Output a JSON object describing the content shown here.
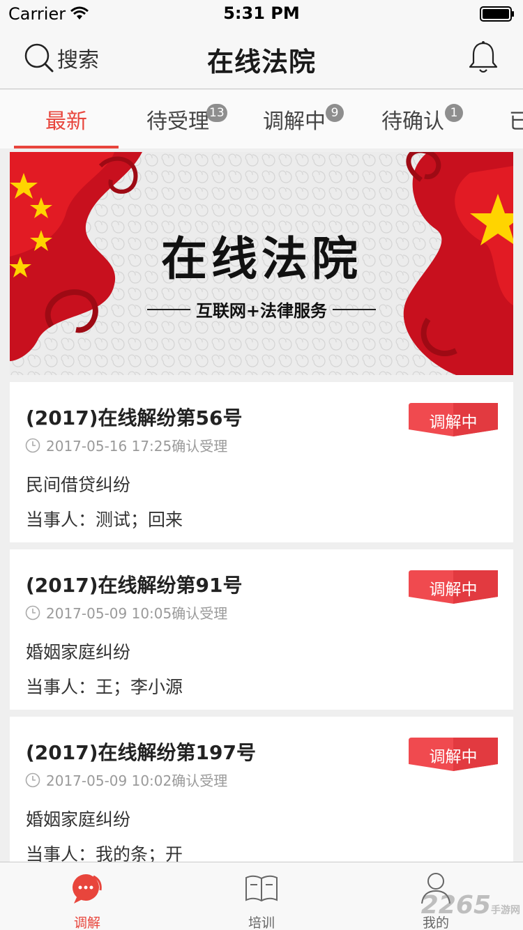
{
  "status_bar": {
    "carrier": "Carrier",
    "time": "5:31 PM"
  },
  "nav": {
    "search_label": "搜索",
    "title": "在线法院"
  },
  "tabs": [
    {
      "label": "最新",
      "badge": ""
    },
    {
      "label": "待受理",
      "badge": "13"
    },
    {
      "label": "调解中",
      "badge": "9"
    },
    {
      "label": "待确认",
      "badge": "1"
    },
    {
      "label": "已",
      "badge": ""
    }
  ],
  "banner": {
    "title": "在线法院",
    "subtitle": "互联网+法律服务"
  },
  "cases": [
    {
      "title": "(2017)在线解纷第56号",
      "time": "2017-05-16 17:25确认受理",
      "type": "民间借贷纠纷",
      "parties_label": "当事人：",
      "parties": "测试；回来",
      "status": "调解中"
    },
    {
      "title": "(2017)在线解纷第91号",
      "time": "2017-05-09 10:05确认受理",
      "type": "婚姻家庭纠纷",
      "parties_label": "当事人：",
      "parties": "王；李小源",
      "status": "调解中"
    },
    {
      "title": "(2017)在线解纷第197号",
      "time": "2017-05-09 10:02确认受理",
      "type": "婚姻家庭纠纷",
      "parties_label": "当事人：",
      "parties": "我的条；开",
      "status": "调解中"
    }
  ],
  "bottom_tabs": [
    {
      "label": "调解",
      "icon": "chat-bubble-icon"
    },
    {
      "label": "培训",
      "icon": "book-icon"
    },
    {
      "label": "我的",
      "icon": "person-icon"
    }
  ],
  "watermark": {
    "brand": "2265",
    "suffix": "手游网"
  },
  "colors": {
    "accent": "#e8453c",
    "status_tag": "#f04a4f",
    "badge": "#8e8e8e"
  }
}
